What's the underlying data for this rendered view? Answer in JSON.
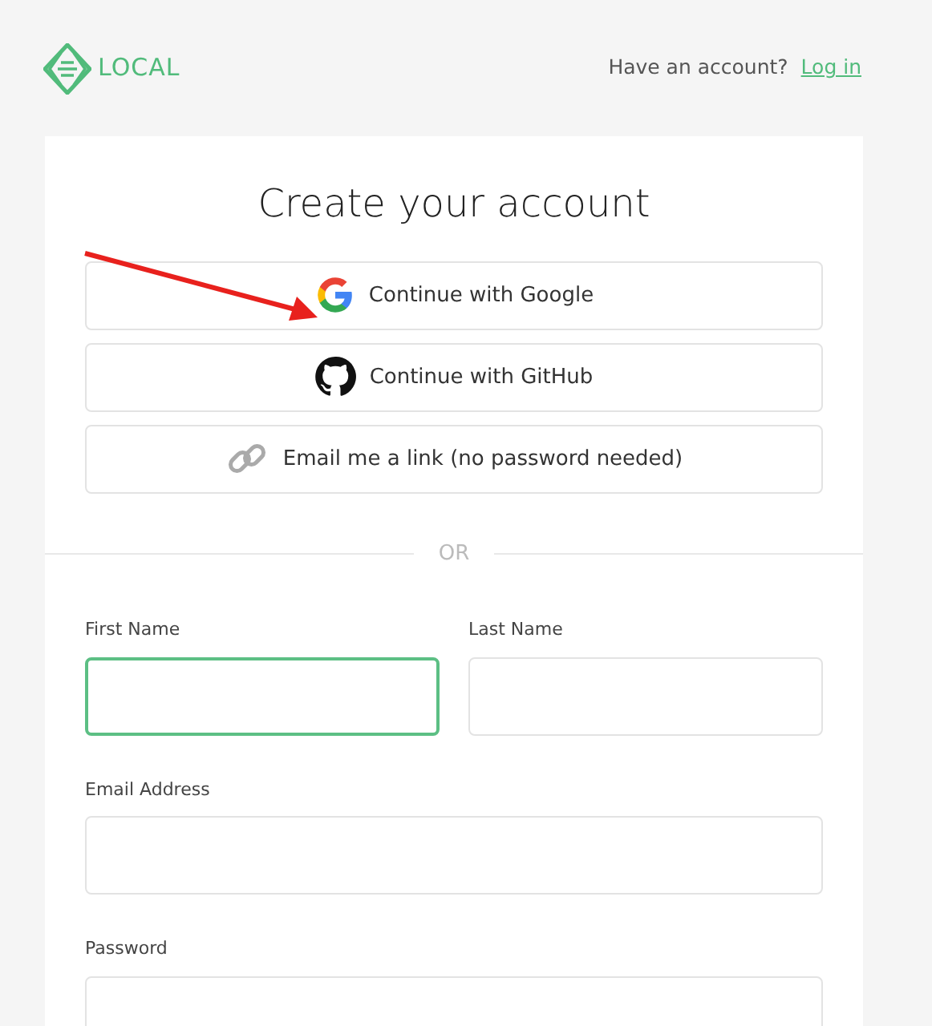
{
  "header": {
    "logo": "LOCAL",
    "prompt": "Have an account?",
    "login_link": "Log in"
  },
  "signup": {
    "title": "Create your account",
    "providers": [
      {
        "kind": "google",
        "label": "Continue with Google"
      },
      {
        "kind": "github",
        "label": "Continue with GitHub"
      },
      {
        "kind": "link",
        "label": "Email me a link (no password needed)"
      }
    ],
    "divider": "OR",
    "fields": [
      {
        "label": "First Name",
        "focused": true,
        "half": true
      },
      {
        "label": "Last Name",
        "focused": false,
        "half": true
      },
      {
        "label": "Email Address",
        "focused": false,
        "half": false
      },
      {
        "label": "Password",
        "focused": false,
        "half": false
      }
    ]
  }
}
